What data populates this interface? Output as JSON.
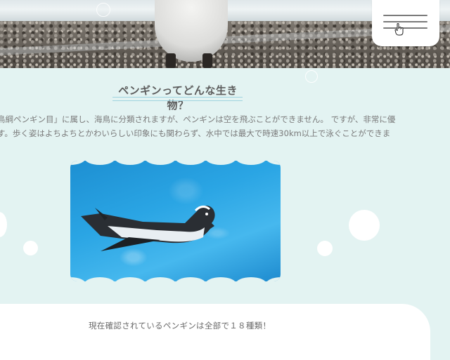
{
  "section": {
    "title": "ペンギンってどんな生き物？",
    "intro_lines": [
      "鳥綱ペンギン目」に属し、海鳥に分類されますが、ペンギンは空を飛ぶことができません。 ですが、非常に優",
      "す。歩く姿はよちよちとかわいらしい印象にも関わらず、水中では最大で時速30km以上で泳ぐことができま"
    ]
  },
  "footer_card": {
    "text": "現在確認されているペンギンは全部で１８種類！"
  },
  "colors": {
    "background": "#e3f3f2",
    "accent_line": "#9fd3df",
    "water": "#2aa5e4"
  },
  "icons": {
    "menu": "hamburger-menu-icon",
    "cursor": "hand-pointer-icon"
  }
}
